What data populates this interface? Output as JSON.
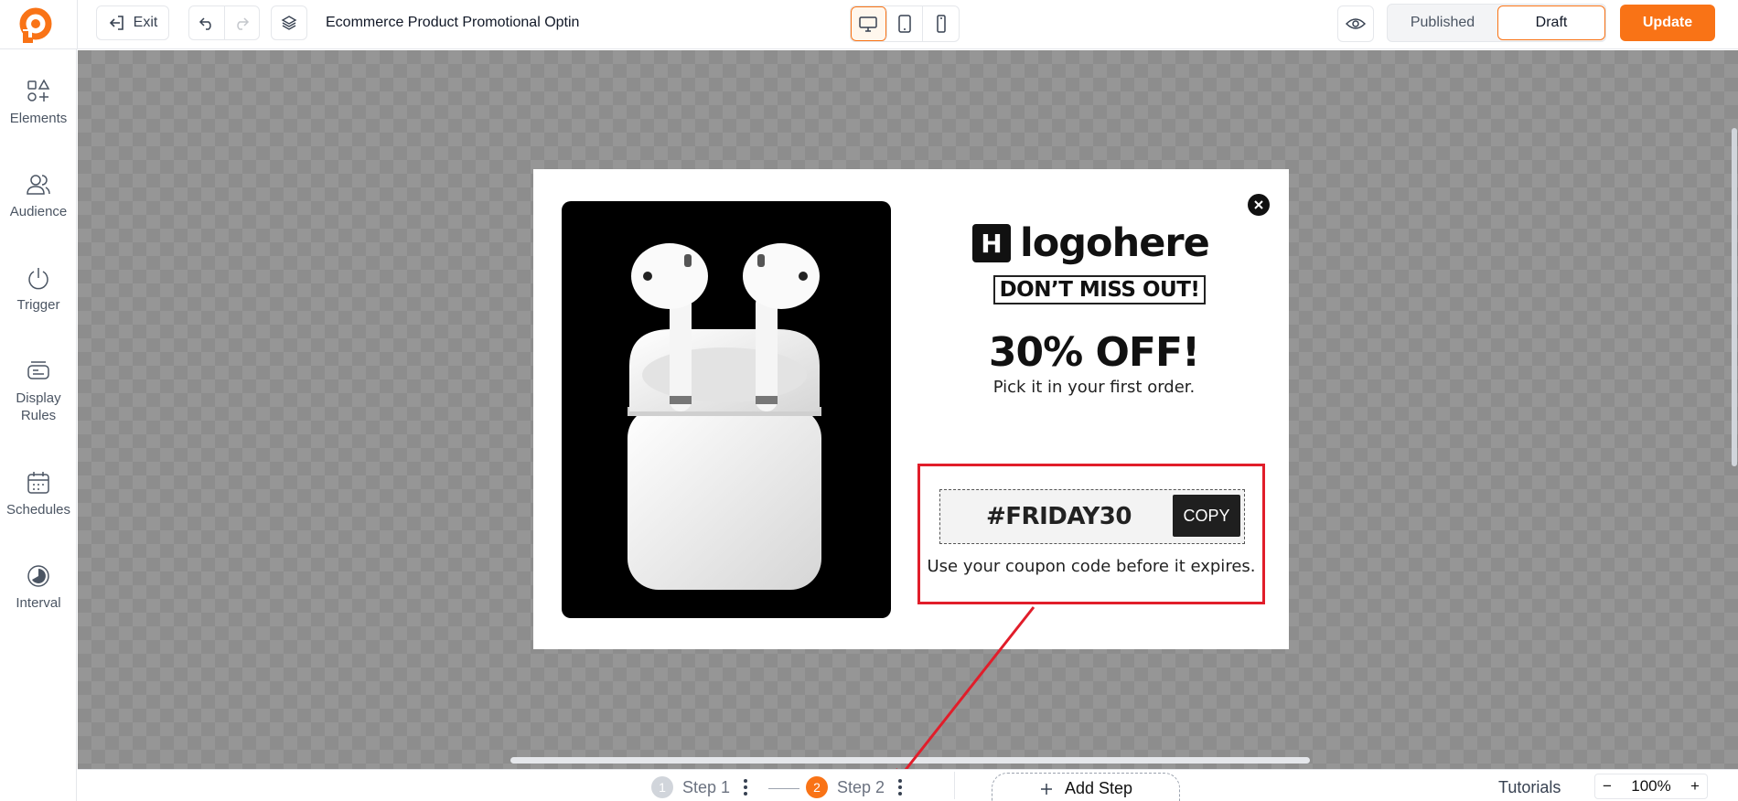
{
  "app": {
    "doc_title": "Ecommerce Product Promotional Optin",
    "exit_label": "Exit",
    "status": {
      "published_label": "Published",
      "draft_label": "Draft"
    },
    "update_label": "Update",
    "accent_color": "#f97316"
  },
  "sidebar": {
    "items": [
      {
        "label": "Elements",
        "icon": "elements-icon"
      },
      {
        "label": "Audience",
        "icon": "audience-icon"
      },
      {
        "label": "Trigger",
        "icon": "power-icon"
      },
      {
        "label": "Display Rules",
        "icon": "display-rules-icon"
      },
      {
        "label": "Schedules",
        "icon": "calendar-icon"
      },
      {
        "label": "Interval",
        "icon": "interval-icon"
      }
    ]
  },
  "popup": {
    "brand": "logohere",
    "brand_mark": "H",
    "tagline": "DON’T MISS OUT!",
    "headline": "30% OFF!",
    "subheadline": "Pick it in your first order.",
    "coupon_code": "#FRIDAY30",
    "copy_label": "COPY",
    "coupon_note": "Use your coupon code before it expires.",
    "highlight_color": "#e11d2a"
  },
  "bottom": {
    "steps": [
      {
        "num": "1",
        "label": "Step 1"
      },
      {
        "num": "2",
        "label": "Step 2"
      }
    ],
    "add_step_label": "Add Step",
    "tutorials_label": "Tutorials",
    "zoom": "100%",
    "zoom_minus": "−",
    "zoom_plus": "+"
  }
}
